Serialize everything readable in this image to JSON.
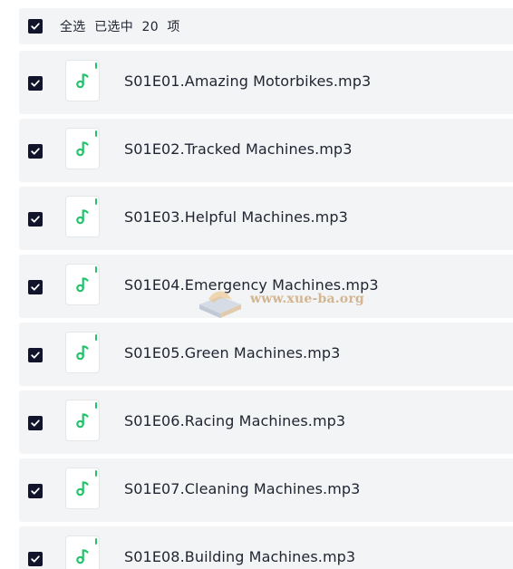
{
  "header": {
    "select_all_checked": true,
    "label": "全选  已选中  20  项"
  },
  "files": [
    {
      "name": "S01E01.Amazing Motorbikes.mp3",
      "checked": true,
      "icon": "music-note-icon"
    },
    {
      "name": "S01E02.Tracked Machines.mp3",
      "checked": true,
      "icon": "music-note-icon"
    },
    {
      "name": "S01E03.Helpful Machines.mp3",
      "checked": true,
      "icon": "music-note-icon"
    },
    {
      "name": "S01E04.Emergency Machines.mp3",
      "checked": true,
      "icon": "music-note-icon"
    },
    {
      "name": "S01E05.Green Machines.mp3",
      "checked": true,
      "icon": "music-note-icon"
    },
    {
      "name": "S01E06.Racing Machines.mp3",
      "checked": true,
      "icon": "music-note-icon"
    },
    {
      "name": "S01E07.Cleaning Machines.mp3",
      "checked": true,
      "icon": "music-note-icon"
    },
    {
      "name": "S01E08.Building Machines.mp3",
      "checked": true,
      "icon": "music-note-icon"
    }
  ],
  "watermark": {
    "text": "www.xue-ba.org"
  },
  "colors": {
    "row_background": "#f3f4f6",
    "checkbox_fill": "#12142b",
    "icon_accent": "#22c36a",
    "text": "#1f2430"
  }
}
